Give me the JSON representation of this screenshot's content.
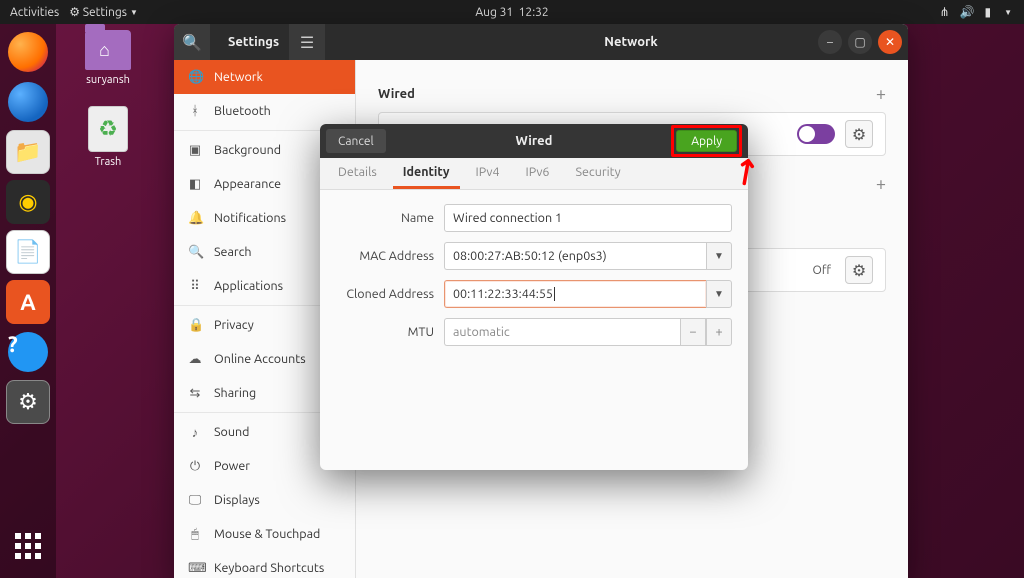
{
  "topbar": {
    "activities": "Activities",
    "app": "Settings",
    "date": "Aug 31",
    "time": "12:32"
  },
  "desktop": {
    "home": "suryansh",
    "trash": "Trash"
  },
  "settings_window": {
    "title_left": "Settings",
    "title_center": "Network",
    "sidebar": [
      "Network",
      "Bluetooth",
      "Background",
      "Appearance",
      "Notifications",
      "Search",
      "Applications",
      "Privacy",
      "Online Accounts",
      "Sharing",
      "Sound",
      "Power",
      "Displays",
      "Mouse & Touchpad",
      "Keyboard Shortcuts"
    ],
    "section1": "Wired",
    "vpn_off": "Off"
  },
  "dialog": {
    "cancel": "Cancel",
    "title": "Wired",
    "apply": "Apply",
    "tabs": [
      "Details",
      "Identity",
      "IPv4",
      "IPv6",
      "Security"
    ],
    "labels": {
      "name": "Name",
      "mac": "MAC Address",
      "cloned": "Cloned Address",
      "mtu": "MTU"
    },
    "values": {
      "name": "Wired connection 1",
      "mac": "08:00:27:AB:50:12 (enp0s3)",
      "cloned": "00:11:22:33:44:55",
      "mtu": "automatic"
    }
  }
}
